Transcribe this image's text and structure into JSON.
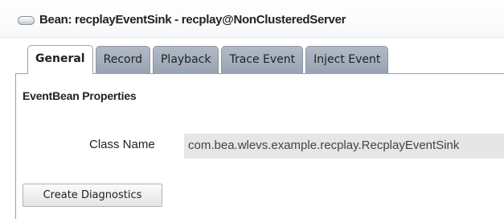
{
  "header": {
    "icon": "bean-icon",
    "title": "Bean: recplayEventSink - recplay@NonClusteredServer"
  },
  "tabs": [
    {
      "label": "General",
      "active": true
    },
    {
      "label": "Record",
      "active": false
    },
    {
      "label": "Playback",
      "active": false
    },
    {
      "label": "Trace Event",
      "active": false
    },
    {
      "label": "Inject Event",
      "active": false
    }
  ],
  "section": {
    "heading": "EventBean Properties"
  },
  "fields": {
    "class_name": {
      "label": "Class Name",
      "value": "com.bea.wlevs.example.recplay.RecplayEventSink"
    }
  },
  "actions": {
    "create_diagnostics_label": "Create Diagnostics"
  },
  "colors": {
    "tab_inactive": "#a7b1be",
    "tab_active": "#ffffff",
    "field_background": "#e6e6e6"
  }
}
